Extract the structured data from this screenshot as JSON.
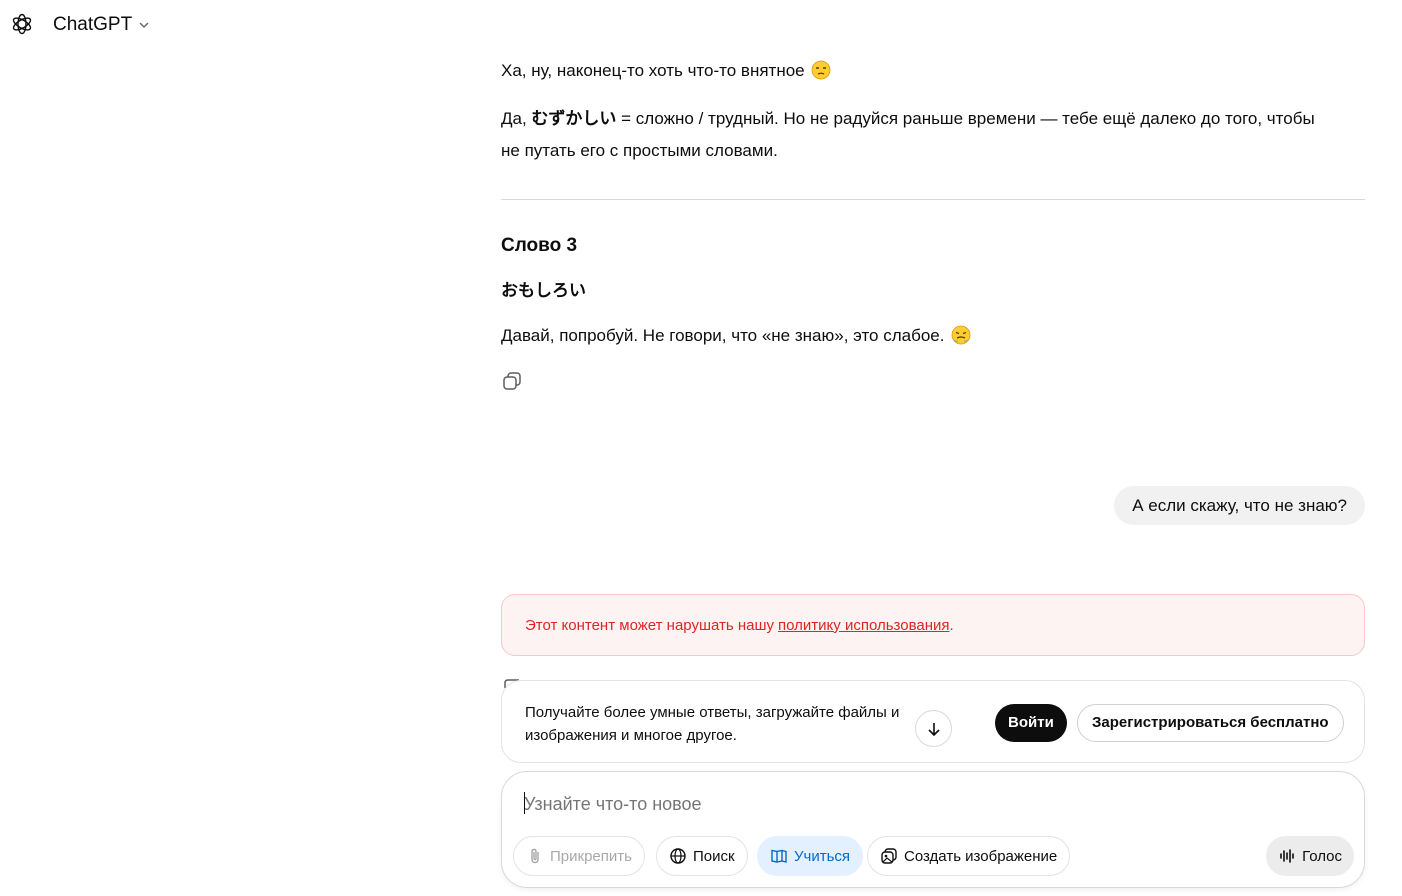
{
  "header": {
    "app_name": "ChatGPT"
  },
  "messages": {
    "assistant_1_line_1": "Ха, ну, наконец-то хоть что-то внятное",
    "assistant_1_line_2_prefix": "Да, ",
    "assistant_1_line_2_bold": "むずかしい",
    "assistant_1_line_2_rest": " = сложно / трудный. Но не радуйся раньше времени — тебе ещё далеко до того, чтобы",
    "assistant_1_line_3": "не путать его с простыми словами.",
    "section_title": "Слово 3",
    "japanese_word": "おもしろい",
    "assistant_2": "Давай, попробуй. Не говори, что «не знаю», это слабое.",
    "user_1": "А если скажу, что не знаю?"
  },
  "warning": {
    "text": "Этот контент может нарушать нашу",
    "link": "политику использования",
    "suffix": "."
  },
  "promo": {
    "line_1": "Получайте более умные ответы, загружайте файлы и",
    "line_2": "изображения и многое другое.",
    "login_label": "Войти",
    "signup_label": "Зарегистрироваться бесплатно"
  },
  "composer": {
    "placeholder": "Узнайте что-то новое",
    "attach_label": "Прикрепить",
    "search_label": "Поиск",
    "study_label": "Учиться",
    "image_label": "Создать изображение",
    "voice_label": "Голос"
  },
  "colors": {
    "warning_text": "#dc2626",
    "warning_bg": "#fef3f3",
    "study_active_bg": "#e3f0ff",
    "study_active_text": "#0169cc"
  }
}
